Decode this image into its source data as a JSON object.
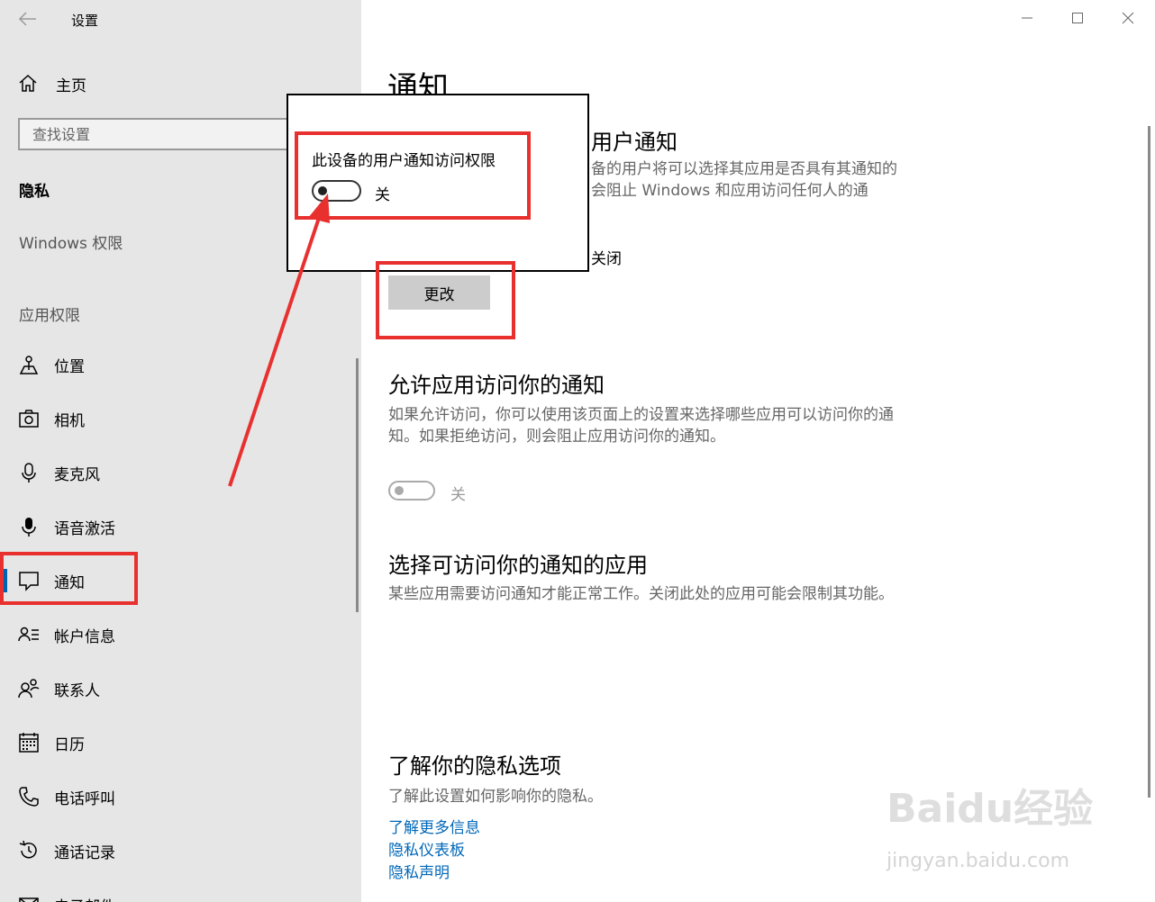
{
  "window": {
    "title": "设置"
  },
  "sidebar": {
    "home_label": "主页",
    "search_placeholder": "查找设置",
    "section_title": "隐私",
    "windows_perm_label": "Windows 权限",
    "app_perm_label": "应用权限",
    "items": [
      {
        "label": "位置",
        "icon": "location-icon"
      },
      {
        "label": "相机",
        "icon": "camera-icon"
      },
      {
        "label": "麦克风",
        "icon": "microphone-icon"
      },
      {
        "label": "语音激活",
        "icon": "voice-activation-icon"
      },
      {
        "label": "通知",
        "icon": "notification-icon",
        "active": true
      },
      {
        "label": "帐户信息",
        "icon": "account-info-icon"
      },
      {
        "label": "联系人",
        "icon": "contacts-icon"
      },
      {
        "label": "日历",
        "icon": "calendar-icon"
      },
      {
        "label": "电话呼叫",
        "icon": "phone-icon"
      },
      {
        "label": "通话记录",
        "icon": "history-icon"
      },
      {
        "label": "电子邮件",
        "icon": "email-icon"
      }
    ]
  },
  "main": {
    "title": "通知",
    "section1": {
      "heading_partial": "用户通知",
      "desc_line1": "备的用户将可以选择其应用是否具有其通知的",
      "desc_line2": "会阻止 Windows 和应用访问任何人的通",
      "status_partial": "关闭",
      "change_button": "更改"
    },
    "section2": {
      "heading": "允许应用访问你的通知",
      "desc": "如果允许访问，你可以使用该页面上的设置来选择哪些应用可以访问你的通知。如果拒绝访问，则会阻止应用访问你的通知。",
      "toggle_state": "关"
    },
    "section3": {
      "heading": "选择可访问你的通知的应用",
      "desc": "某些应用需要访问通知才能正常工作。关闭此处的应用可能会限制其功能。"
    },
    "section4": {
      "heading": "了解你的隐私选项",
      "desc": "了解此设置如何影响你的隐私。",
      "links": [
        "了解更多信息",
        "隐私仪表板",
        "隐私声明"
      ]
    }
  },
  "popup": {
    "label": "此设备的用户通知访问权限",
    "toggle_state": "关"
  },
  "annotation_color": "#e8312f",
  "watermark": {
    "logo_text": "Baidu经验",
    "url": "jingyan.baidu.com"
  }
}
